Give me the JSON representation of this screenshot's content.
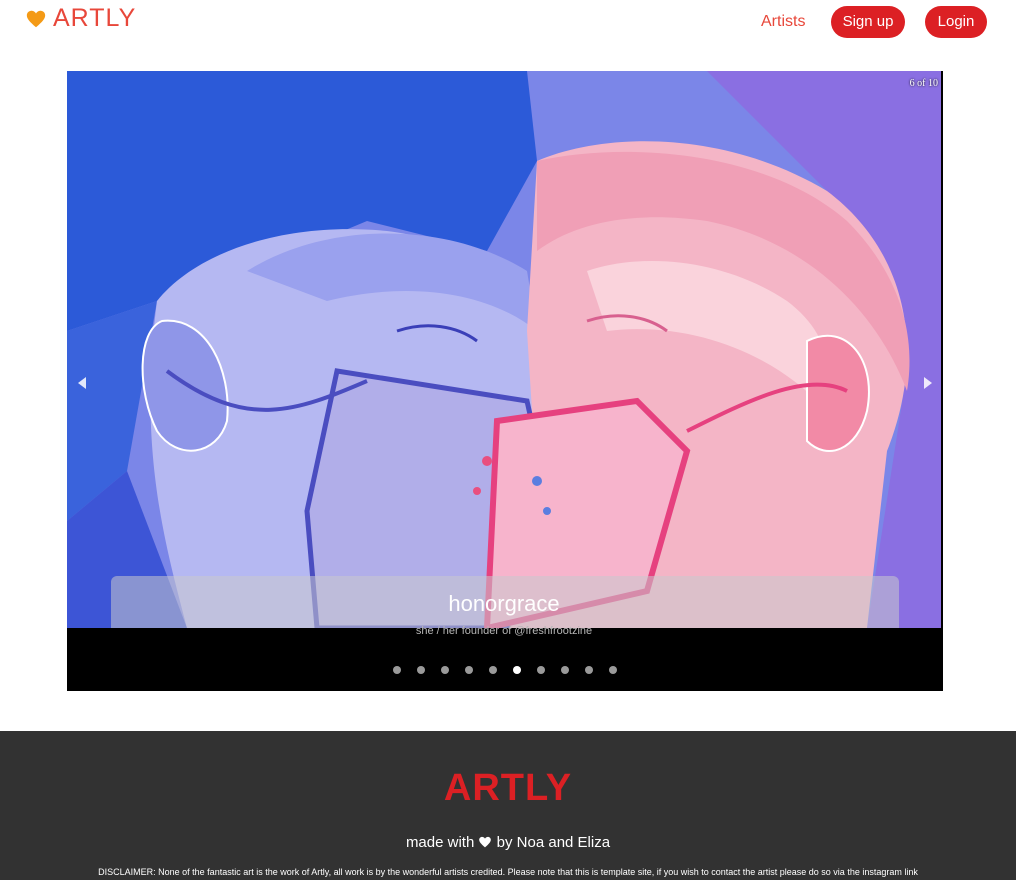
{
  "header": {
    "brand_name": "ARTLY",
    "brand_icon": "orange-heart-icon",
    "nav_artists": "Artists",
    "signup_label": "Sign up",
    "login_label": "Login"
  },
  "carousel": {
    "counter": "6 of 10",
    "caption_title": "honorgrace",
    "caption_subtitle": "she / her founder of @freshfrootzine",
    "slide_count": 10,
    "active_index": 6,
    "image_description_icon": "illustration-masked-kiss"
  },
  "footer": {
    "logo": "ARTLY",
    "made_prefix": "made with",
    "made_suffix": "by Noa and Eliza",
    "disclaimer": "DISCLAIMER: None of the fantastic art is the work of Artly, all work is by the wonderful artists credited. Please note that this is template site, if you wish to contact the artist please do so via the instagram link"
  },
  "colors": {
    "brand_red": "#dc2024",
    "brand_text": "#e8473a",
    "footer_bg": "#323232"
  }
}
